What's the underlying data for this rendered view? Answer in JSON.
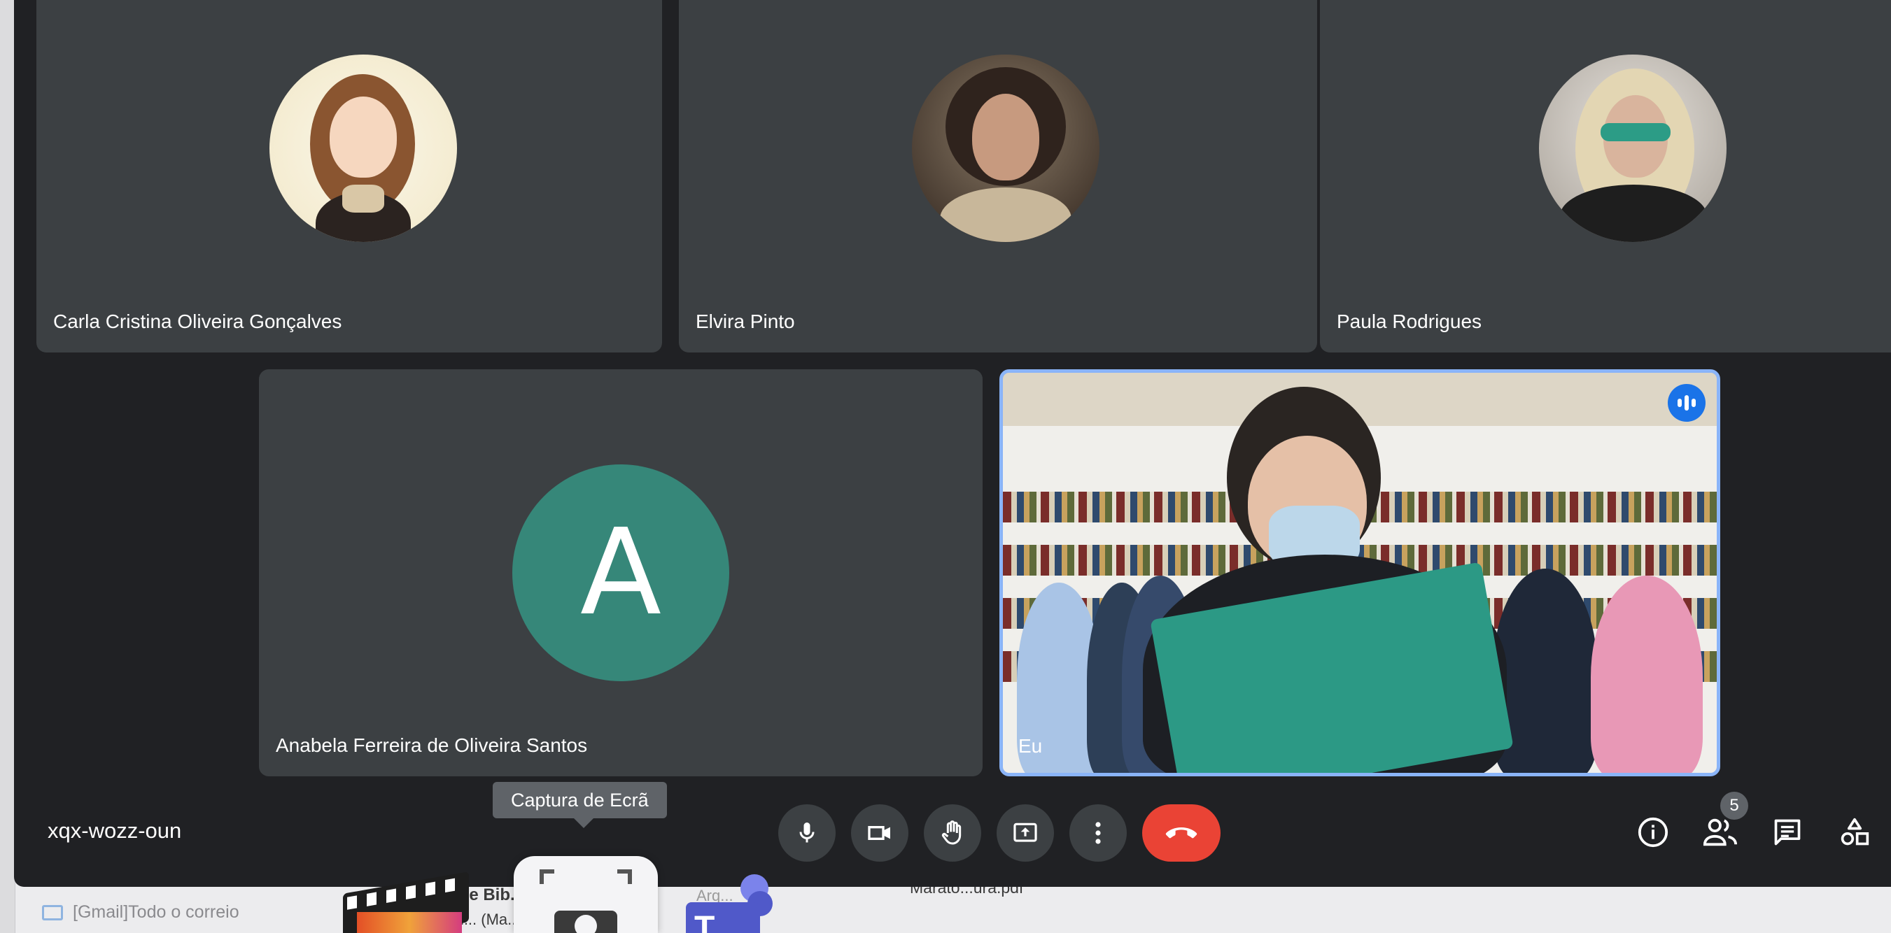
{
  "meeting": {
    "code": "xqx-wozz-oun",
    "participant_count": "5",
    "tooltip": "Captura de Ecrã"
  },
  "participants": [
    {
      "name": "Carla Cristina Oliveira Gonçalves"
    },
    {
      "name": "Elvira Pinto"
    },
    {
      "name": "Paula Rodrigues"
    },
    {
      "name": "Anabela Ferreira de Oliveira Santos",
      "initial": "A"
    },
    {
      "name": "Eu"
    }
  ],
  "background": {
    "gmail_folder": "[Gmail]Todo o correio",
    "subject": "Artur e Bib... o...",
    "subject_line2": "de d... (Ma...",
    "arq": "Arq...",
    "file": "Marato...ura.pdf"
  },
  "icons": {
    "mic": "microphone-icon",
    "camera": "videocam-icon",
    "hand": "raise-hand-icon",
    "present": "present-screen-icon",
    "more": "more-vert-icon",
    "hangup": "call-end-icon",
    "info": "info-icon",
    "people": "people-icon",
    "chat": "chat-icon",
    "activities": "activities-icon"
  },
  "colors": {
    "background": "#202124",
    "tile": "#3c4043",
    "hangup": "#ea4335",
    "active_border": "#8ab4f8",
    "avatar_green": "#368779"
  }
}
